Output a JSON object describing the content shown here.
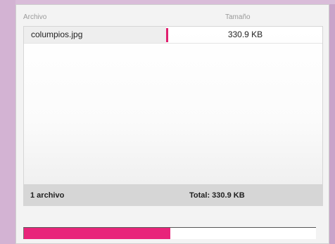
{
  "colors": {
    "accent": "#e8247a",
    "background": "#c9a3c9",
    "panel": "#f3f3f3"
  },
  "table": {
    "columns": [
      "Archivo",
      "Tamaño"
    ],
    "rows": [
      {
        "name": "columpios.jpg",
        "size": "330.9 KB"
      }
    ]
  },
  "footer": {
    "count": "1 archivo",
    "total": "Total: 330.9 KB"
  },
  "progress": {
    "fraction": 0.5
  }
}
